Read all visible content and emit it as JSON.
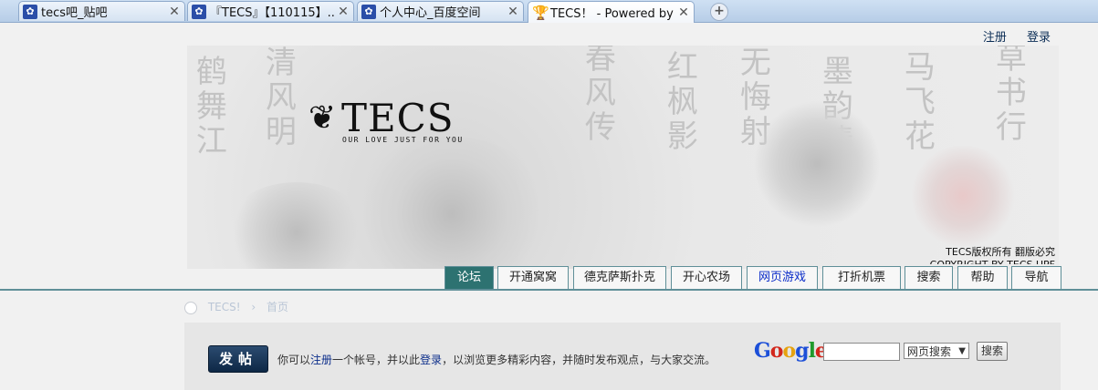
{
  "browser": {
    "tabs": [
      {
        "title": "tecs吧_贴吧",
        "icon": "baidu-paw-icon"
      },
      {
        "title": "『TECS』【110115】...",
        "icon": "baidu-paw-icon"
      },
      {
        "title": "个人中心_百度空间",
        "icon": "baidu-paw-icon"
      },
      {
        "title": "TECS！ - Powered by ...",
        "icon": "trophy-icon",
        "active": true
      }
    ],
    "new_tab": "+"
  },
  "top_links": {
    "register": "注册",
    "login": "登录"
  },
  "banner": {
    "logo_text": "TECS",
    "tagline": "OUR LOVE JUST FOR YOU",
    "copyright_line1": "TECS版权所有 翻版必究",
    "copyright_line2": "COPYRIGHT BY TECS UPF"
  },
  "nav": [
    {
      "label": "论坛",
      "active": true
    },
    {
      "label": "开通窝窝"
    },
    {
      "label": "德克萨斯扑克"
    },
    {
      "label": "开心农场"
    },
    {
      "label": "网页游戏",
      "blue": true
    },
    {
      "label": "打折机票"
    },
    {
      "label": "搜索"
    },
    {
      "label": "帮助"
    },
    {
      "label": "导航"
    }
  ],
  "breadcrumb": {
    "site": "TECS!",
    "page": "首页"
  },
  "content": {
    "post_button": "发帖",
    "info_before": "你可以",
    "info_register": "注册",
    "info_mid": "一个帐号，并以此",
    "info_login": "登录",
    "info_after": "，以浏览更多精彩内容，并随时发布观点，与大家交流。",
    "search": {
      "brand": "Google",
      "input_value": "",
      "select_value": "网页搜索",
      "button": "搜索"
    }
  }
}
